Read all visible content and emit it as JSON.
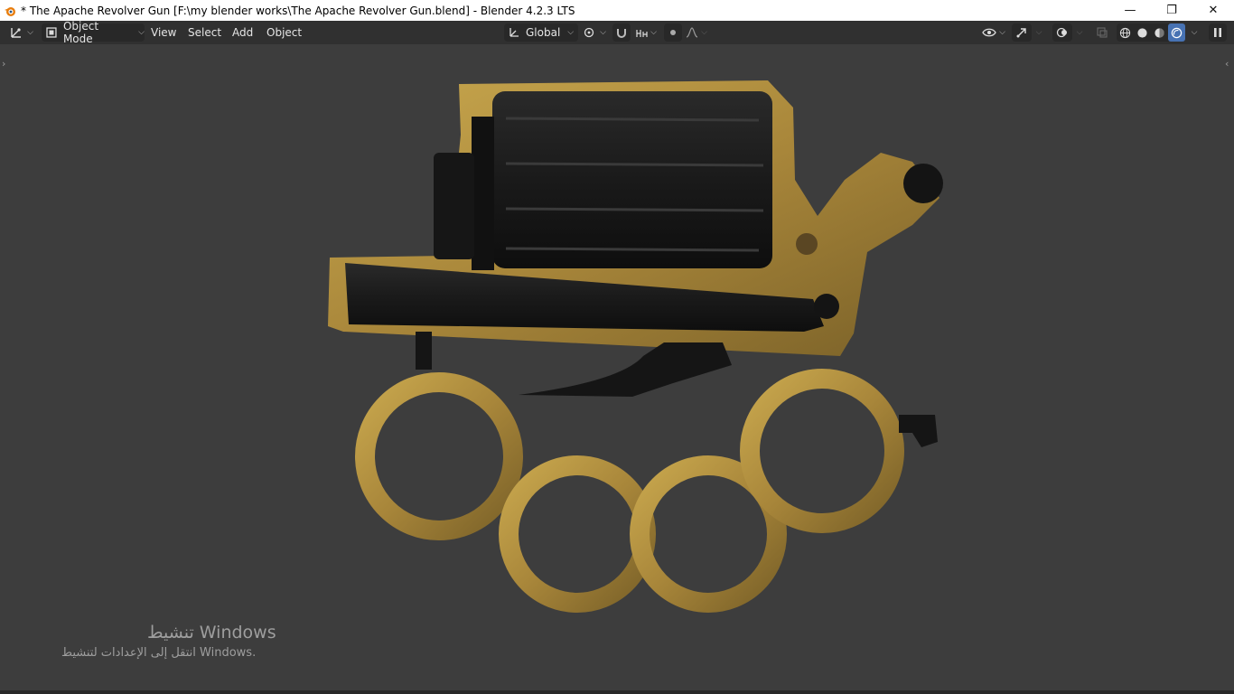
{
  "window": {
    "title": "* The Apache Revolver Gun [F:\\my blender works\\The Apache Revolver Gun.blend] - Blender 4.2.3 LTS",
    "controls": {
      "minimize": "—",
      "restore": "❐",
      "close": "✕"
    }
  },
  "header": {
    "editor_type_icon": "editor-type-icon",
    "mode": "Object Mode",
    "menus": [
      "View",
      "Select",
      "Add",
      "Object"
    ],
    "transform_orientation": "Global",
    "shading_active": "rendered",
    "colors": {
      "accent": "#4772b3",
      "header_bg": "#303030",
      "viewport_bg": "#3d3d3d"
    }
  },
  "viewport": {
    "model": "brass knuckle revolver",
    "watermark": {
      "line1": "تنشيط Windows",
      "line2": "انتقل إلى الإعدادات لتنشيط Windows."
    }
  }
}
